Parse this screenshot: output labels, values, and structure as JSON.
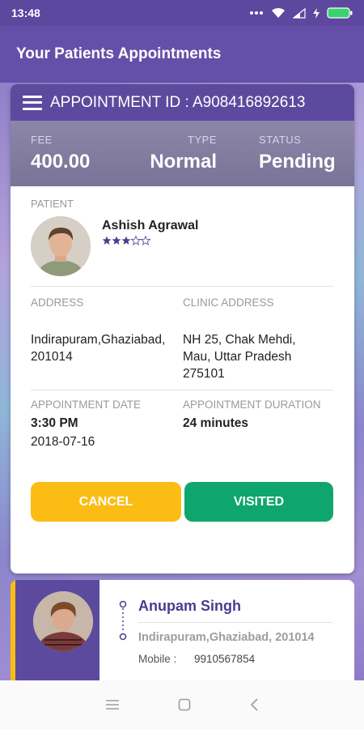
{
  "status_bar": {
    "time": "13:48"
  },
  "header": {
    "title": "Your Patients Appointments"
  },
  "appointment": {
    "id_label": "APPOINTMENT ID : A908416892613",
    "fee_label": "FEE",
    "fee_value": "400.00",
    "type_label": "TYPE",
    "type_value": "Normal",
    "status_label": "STATUS",
    "status_value": "Pending",
    "patient_label": "PATIENT",
    "patient_name": "Ashish Agrawal",
    "patient_rating": 3.5,
    "address_label": "ADDRESS",
    "address_value": "Indirapuram,Ghaziabad,\n201014",
    "clinic_label": "CLINIC ADDRESS",
    "clinic_value": "NH 25, Chak Mehdi,\nMau, Uttar Pradesh\n275101",
    "date_label": "APPOINTMENT DATE",
    "time_value": "3:30 PM",
    "date_value": "2018-07-16",
    "duration_label": "APPOINTMENT DURATION",
    "duration_value": "24 minutes",
    "cancel_label": "CANCEL",
    "visited_label": "VISITED"
  },
  "next_card": {
    "name": "Anupam Singh",
    "address": "Indirapuram,Ghaziabad, 201014",
    "mobile_label": "Mobile :",
    "mobile_value": "9910567854"
  },
  "colors": {
    "primary": "#5c4a9e",
    "cancel": "#fbbd14",
    "visited": "#0ea66e"
  }
}
